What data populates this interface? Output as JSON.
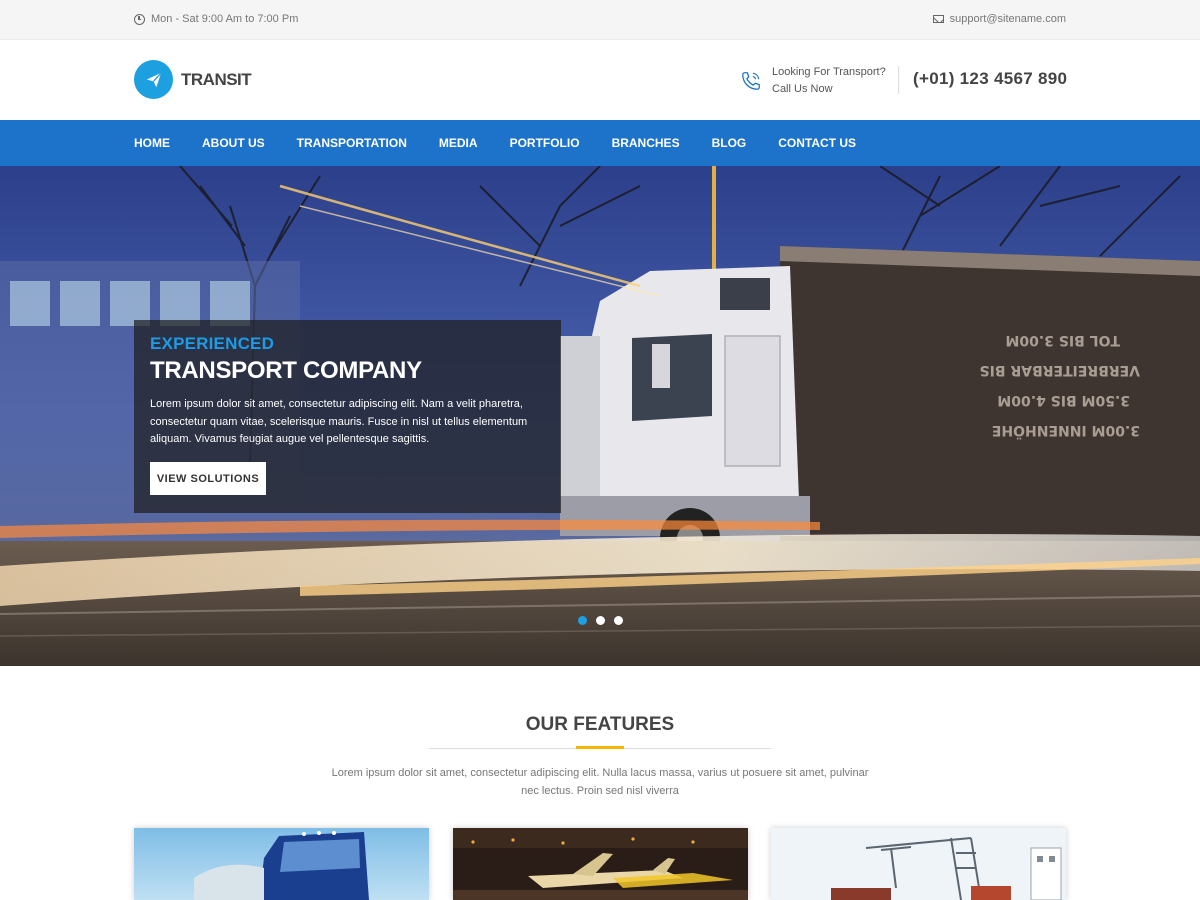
{
  "topbar": {
    "hours": "Mon - Sat 9:00 Am to 7:00 Pm",
    "hours_icon": "clock-icon",
    "email": "support@sitename.com",
    "email_icon": "envelope-icon"
  },
  "header": {
    "logo_text": "TRANSIT",
    "logo_icon": "paper-plane-icon",
    "brand_color": "#1da0e0",
    "phone_icon": "phone-icon",
    "phone_line1": "Looking For Transport?",
    "phone_line2": "Call Us Now",
    "phone_number": "(+01) 123 4567 890"
  },
  "nav": {
    "background": "#1d73c9",
    "items": [
      {
        "label": "HOME"
      },
      {
        "label": "ABOUT US"
      },
      {
        "label": "TRANSPORTATION"
      },
      {
        "label": "MEDIA"
      },
      {
        "label": "PORTFOLIO"
      },
      {
        "label": "BRANCHES"
      },
      {
        "label": "BLOG"
      },
      {
        "label": "CONTACT US"
      }
    ]
  },
  "hero": {
    "kicker": "EXPERIENCED",
    "title": "TRANSPORT COMPANY",
    "text": "Lorem ipsum dolor sit amet, consectetur adipiscing elit. Nam a velit pharetra, consectetur quam vitae, scelerisque mauris. Fusce in nisl ut tellus elementum aliquam. Vivamus feugiat augue vel pellentesque sagittis.",
    "button": "VIEW SOLUTIONS",
    "slides_total": 3,
    "active_slide": 1
  },
  "features": {
    "title": "OUR FEATURES",
    "accent_color": "#f2b705",
    "description": "Lorem ipsum dolor sit amet, consectetur adipiscing elit. Nulla lacus massa, varius ut posuere sit amet, pulvinar nec lectus. Proin sed nisl viverra",
    "cards": [
      {
        "image": "blue-truck-photo"
      },
      {
        "image": "airport-night-photo"
      },
      {
        "image": "port-cranes-photo"
      }
    ]
  }
}
